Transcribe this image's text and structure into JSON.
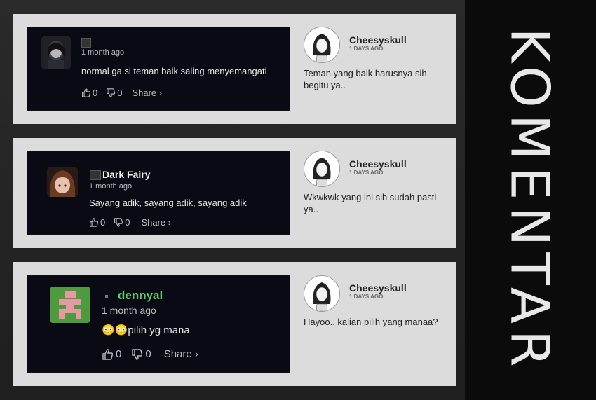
{
  "side_title": "KOMENTAR",
  "comments": [
    {
      "username": "",
      "time": "1 month ago",
      "text": "normal ga si teman baik saling menyemangati",
      "likes": "0",
      "dislikes": "0",
      "share": "Share ›",
      "reply": {
        "name": "Cheesyskull",
        "time": "1 DAYS AGO",
        "text": "Teman yang baik harusnya sih begitu ya.."
      }
    },
    {
      "username": "Dark Fairy",
      "time": "1 month ago",
      "text": "Sayang adik, sayang adik, sayang adik",
      "likes": "0",
      "dislikes": "0",
      "share": "Share ›",
      "reply": {
        "name": "Cheesyskull",
        "time": "1 DAYS AGO",
        "text": "Wkwkwk yang ini sih sudah pasti ya.."
      }
    },
    {
      "username": "dennyal",
      "time": "1 month ago",
      "text": "😳😳pilih yg mana",
      "likes": "0",
      "dislikes": "0",
      "share": "Share ›",
      "reply": {
        "name": "Cheesyskull",
        "time": "1 DAYS AGO",
        "text": "Hayoo.. kalian pilih yang manaa?"
      }
    }
  ],
  "colors": {
    "username_green": "#5cc96a",
    "panel": "#dcdcdc",
    "card": "#0a0a14"
  },
  "icons": [
    "thumbs-up-icon",
    "thumbs-down-icon",
    "badge-icon",
    "chevron-right-icon"
  ]
}
